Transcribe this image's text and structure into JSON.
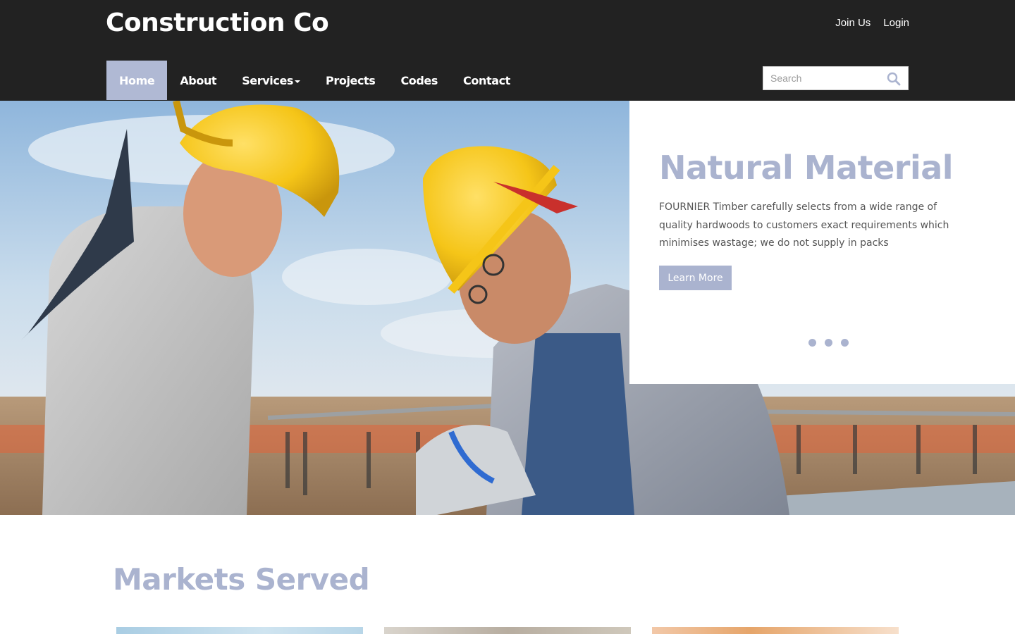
{
  "header": {
    "brand": "Construction Co",
    "top_links": [
      "Join Us",
      "Login"
    ]
  },
  "nav": {
    "items": [
      {
        "label": "Home",
        "active": true
      },
      {
        "label": "About",
        "active": false
      },
      {
        "label": "Services",
        "active": false,
        "dropdown": true
      },
      {
        "label": "Projects",
        "active": false
      },
      {
        "label": "Codes",
        "active": false
      },
      {
        "label": "Contact",
        "active": false
      }
    ]
  },
  "search": {
    "placeholder": "Search",
    "icon": "search-icon"
  },
  "hero": {
    "image": "construction-workers-hard-hats-photo",
    "slide": {
      "title": "Natural Material",
      "text": "FOURNIER Timber carefully selects from a wide range of quality hardwoods to customers exact requirements which minimises wastage; we do not supply in packs",
      "button": "Learn More",
      "dots_count": 3
    }
  },
  "markets": {
    "title": "Markets Served"
  },
  "colors": {
    "header_bg": "#222222",
    "accent": "#aab3cf",
    "active_nav": "#b0b9d4",
    "body_text": "#555555"
  }
}
